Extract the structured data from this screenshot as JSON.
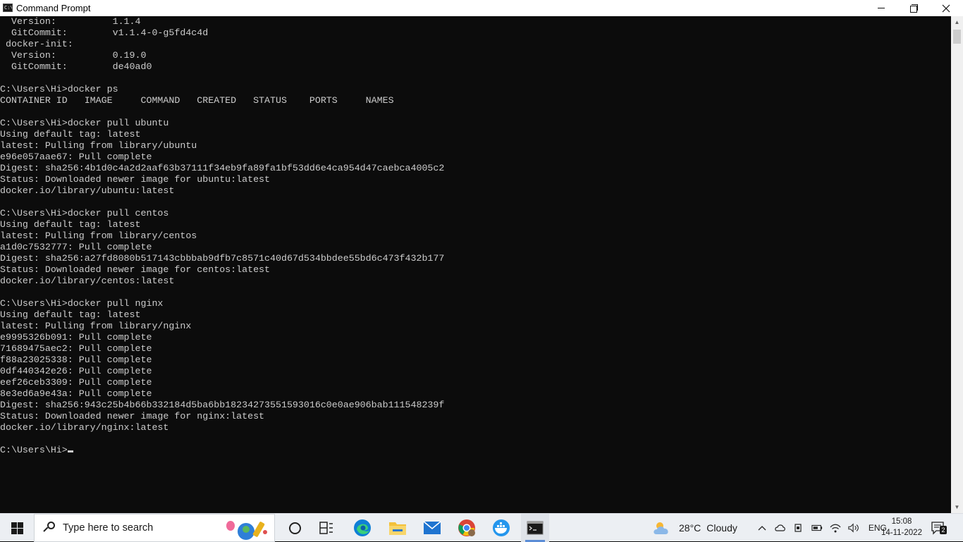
{
  "window": {
    "title": "Command Prompt",
    "icon_label": "C:\\_",
    "controls": {
      "minimize": "minimize-icon",
      "restore": "restore-icon",
      "close": "close-icon"
    }
  },
  "console": {
    "lines": [
      "  Version:          1.1.4",
      "  GitCommit:        v1.1.4-0-g5fd4c4d",
      " docker-init:",
      "  Version:          0.19.0",
      "  GitCommit:        de40ad0",
      "",
      "C:\\Users\\Hi>docker ps",
      "CONTAINER ID   IMAGE     COMMAND   CREATED   STATUS    PORTS     NAMES",
      "",
      "C:\\Users\\Hi>docker pull ubuntu",
      "Using default tag: latest",
      "latest: Pulling from library/ubuntu",
      "e96e057aae67: Pull complete",
      "Digest: sha256:4b1d0c4a2d2aaf63b37111f34eb9fa89fa1bf53dd6e4ca954d47caebca4005c2",
      "Status: Downloaded newer image for ubuntu:latest",
      "docker.io/library/ubuntu:latest",
      "",
      "C:\\Users\\Hi>docker pull centos",
      "Using default tag: latest",
      "latest: Pulling from library/centos",
      "a1d0c7532777: Pull complete",
      "Digest: sha256:a27fd8080b517143cbbbab9dfb7c8571c40d67d534bbdee55bd6c473f432b177",
      "Status: Downloaded newer image for centos:latest",
      "docker.io/library/centos:latest",
      "",
      "C:\\Users\\Hi>docker pull nginx",
      "Using default tag: latest",
      "latest: Pulling from library/nginx",
      "e9995326b091: Pull complete",
      "71689475aec2: Pull complete",
      "f88a23025338: Pull complete",
      "0df440342e26: Pull complete",
      "eef26ceb3309: Pull complete",
      "8e3ed6a9e43a: Pull complete",
      "Digest: sha256:943c25b4b66b332184d5ba6bb18234273551593016c0e0ae906bab111548239f",
      "Status: Downloaded newer image for nginx:latest",
      "docker.io/library/nginx:latest",
      ""
    ],
    "prompt": "C:\\Users\\Hi>"
  },
  "taskbar": {
    "search_placeholder": "Type here to search",
    "apps": [
      {
        "name": "edge",
        "icon": "edge-icon",
        "color": "#0f7fd6"
      },
      {
        "name": "file-explorer",
        "icon": "folder-icon",
        "color": "#f3c13a"
      },
      {
        "name": "mail",
        "icon": "mail-icon",
        "color": "#1f74d0"
      },
      {
        "name": "chrome",
        "icon": "chrome-icon",
        "color": "#db4437"
      },
      {
        "name": "docker",
        "icon": "docker-icon",
        "color": "#2496ed"
      },
      {
        "name": "command-prompt",
        "icon": "cmd-icon",
        "color": "#1a1a1a"
      }
    ],
    "weather": {
      "temp": "28°C",
      "condition": "Cloudy"
    },
    "language": "ENG",
    "time": "15:08",
    "date": "14-11-2022",
    "notifications": "2"
  }
}
